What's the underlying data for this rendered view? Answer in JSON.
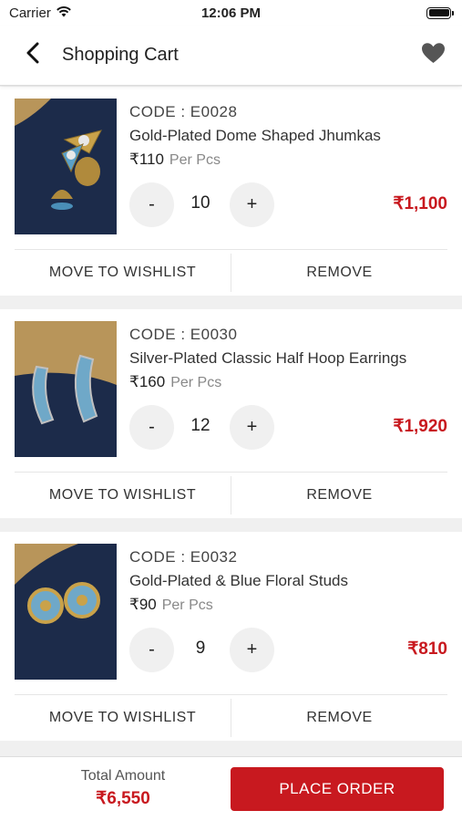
{
  "status_bar": {
    "carrier": "Carrier",
    "time": "12:06 PM"
  },
  "header": {
    "title": "Shopping Cart"
  },
  "cart": {
    "items": [
      {
        "code": "CODE : E0028",
        "name": "Gold-Plated Dome Shaped Jhumkas",
        "price": "₹110",
        "unit": "Per Pcs",
        "minus": "-",
        "quantity": "10",
        "plus": "+",
        "line_total": "₹1,100",
        "wishlist_label": "MOVE TO WISHLIST",
        "remove_label": "REMOVE"
      },
      {
        "code": "CODE : E0030",
        "name": "Silver-Plated Classic Half Hoop Earrings",
        "price": "₹160",
        "unit": "Per Pcs",
        "minus": "-",
        "quantity": "12",
        "plus": "+",
        "line_total": "₹1,920",
        "wishlist_label": "MOVE TO WISHLIST",
        "remove_label": "REMOVE"
      },
      {
        "code": "CODE : E0032",
        "name": "Gold-Plated & Blue Floral Studs",
        "price": "₹90",
        "unit": "Per Pcs",
        "minus": "-",
        "quantity": "9",
        "plus": "+",
        "line_total": "₹810",
        "wishlist_label": "MOVE TO WISHLIST",
        "remove_label": "REMOVE"
      }
    ]
  },
  "footer": {
    "total_label": "Total Amount",
    "total_value": "₹6,550",
    "place_order_label": "PLACE ORDER"
  },
  "colors": {
    "accent": "#c8191f",
    "qty_button_bg": "#f0f0f0",
    "page_bg": "#f0f0f0",
    "product_bg": "#1c2b4a"
  },
  "icons": {
    "back": "chevron-left-icon",
    "wishlist": "heart-icon",
    "wifi": "wifi-icon",
    "battery": "battery-icon"
  }
}
